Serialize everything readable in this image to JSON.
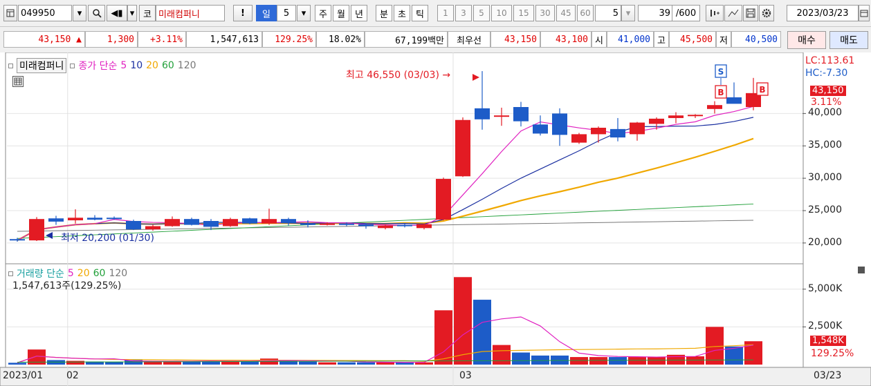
{
  "toolbar": {
    "code": "049950",
    "market_badge": "코",
    "stock_name": "미래컴퍼니",
    "alert_label": "!",
    "period_day": "일",
    "period_day_count": "5",
    "period_week": "주",
    "period_month": "월",
    "period_year": "년",
    "period_minute": "분",
    "period_second": "초",
    "period_tick": "틱",
    "intraday_counts": [
      "1",
      "3",
      "5",
      "10",
      "15",
      "30",
      "45",
      "60"
    ],
    "interval_value": "5",
    "data_count": "39",
    "data_total": "/600",
    "date": "2023/03/23"
  },
  "quote": {
    "price": "43,150",
    "change_arrow": "▲",
    "change": "1,300",
    "change_pct": "+3.11%",
    "volume": "1,547,613",
    "volume_ratio": "129.25%",
    "turnover": "18.02%",
    "amount": "67,199백만",
    "best_quote_label": "최우선",
    "ask": "43,150",
    "bid": "43,100",
    "open_label": "시",
    "open": "41,000",
    "high_label": "고",
    "high": "45,500",
    "low_label": "저",
    "low": "40,500",
    "buy_label": "매수",
    "sell_label": "매도"
  },
  "price_panel": {
    "legend_name": "미래컴퍼니",
    "legend_ma_label": "종가 단순",
    "ma_periods": [
      "5",
      "10",
      "20",
      "60",
      "120"
    ],
    "high_annotation": "최고 46,550 (03/03) →",
    "low_annotation": "최저 20,200 (01/30)",
    "lc_label": "LC:113.61",
    "hc_label": "HC:-7.30",
    "last_price_tag": "43,150",
    "last_pct_tag": "3.11%",
    "y_ticks": [
      "40,000",
      "35,000",
      "30,000",
      "25,000",
      "20,000"
    ],
    "signal_sell": "S",
    "signal_buy": "B"
  },
  "volume_panel": {
    "legend_label": "거래량 단순",
    "ma_periods": [
      "5",
      "20",
      "60",
      "120"
    ],
    "info": "1,547,613주(129.25%)",
    "y_ticks": [
      "5,000K",
      "2,500K"
    ],
    "last_vol_tag": "1,548K",
    "last_pct_tag": "129.25%"
  },
  "x_axis": {
    "labels": [
      "2023/01",
      "02",
      "03",
      "03/23"
    ]
  },
  "colors": {
    "up": "#e31b23",
    "down": "#1d5cc8",
    "ma5": "#e020c0",
    "ma10": "#1a2fa0",
    "ma20": "#f0a800",
    "ma60": "#22a03a",
    "ma120": "#777777"
  },
  "chart_data": {
    "type": "candlestick",
    "price_ylim": [
      17000,
      49000
    ],
    "volume_ylim": [
      0,
      6500000
    ],
    "candles": [
      {
        "o": 20600,
        "h": 20800,
        "l": 20200,
        "c": 20400,
        "v": 120000
      },
      {
        "o": 20400,
        "h": 24000,
        "l": 20300,
        "c": 23700,
        "v": 1000000
      },
      {
        "o": 23800,
        "h": 24200,
        "l": 22800,
        "c": 23300,
        "v": 300000
      },
      {
        "o": 23500,
        "h": 25200,
        "l": 23000,
        "c": 23900,
        "v": 250000
      },
      {
        "o": 23900,
        "h": 24300,
        "l": 23500,
        "c": 23600,
        "v": 200000
      },
      {
        "o": 23900,
        "h": 24100,
        "l": 23600,
        "c": 23700,
        "v": 180000
      },
      {
        "o": 23400,
        "h": 23600,
        "l": 22000,
        "c": 22100,
        "v": 300000
      },
      {
        "o": 22100,
        "h": 22800,
        "l": 21900,
        "c": 22600,
        "v": 200000
      },
      {
        "o": 22600,
        "h": 24100,
        "l": 22500,
        "c": 23700,
        "v": 250000
      },
      {
        "o": 23700,
        "h": 23900,
        "l": 22700,
        "c": 22800,
        "v": 200000
      },
      {
        "o": 23400,
        "h": 23700,
        "l": 22000,
        "c": 22500,
        "v": 250000
      },
      {
        "o": 22600,
        "h": 23900,
        "l": 22500,
        "c": 23700,
        "v": 250000
      },
      {
        "o": 23800,
        "h": 23900,
        "l": 22900,
        "c": 23000,
        "v": 200000
      },
      {
        "o": 23000,
        "h": 25300,
        "l": 22800,
        "c": 23700,
        "v": 400000
      },
      {
        "o": 23700,
        "h": 23900,
        "l": 22700,
        "c": 23100,
        "v": 250000
      },
      {
        "o": 23000,
        "h": 23500,
        "l": 22400,
        "c": 22900,
        "v": 200000
      },
      {
        "o": 22900,
        "h": 23200,
        "l": 22700,
        "c": 23000,
        "v": 150000
      },
      {
        "o": 23000,
        "h": 23200,
        "l": 22600,
        "c": 22800,
        "v": 150000
      },
      {
        "o": 22900,
        "h": 23100,
        "l": 22200,
        "c": 22600,
        "v": 150000
      },
      {
        "o": 22300,
        "h": 22800,
        "l": 22100,
        "c": 22700,
        "v": 150000
      },
      {
        "o": 22800,
        "h": 23000,
        "l": 22400,
        "c": 22600,
        "v": 150000
      },
      {
        "o": 22300,
        "h": 23000,
        "l": 22100,
        "c": 22900,
        "v": 150000
      },
      {
        "o": 23600,
        "h": 30100,
        "l": 23500,
        "c": 29900,
        "v": 3600000
      },
      {
        "o": 30300,
        "h": 39400,
        "l": 30200,
        "c": 39000,
        "v": 5800000
      },
      {
        "o": 40800,
        "h": 46550,
        "l": 37500,
        "c": 39100,
        "v": 4300000
      },
      {
        "o": 39600,
        "h": 40900,
        "l": 38100,
        "c": 39700,
        "v": 1300000
      },
      {
        "o": 41000,
        "h": 41800,
        "l": 38000,
        "c": 38800,
        "v": 800000
      },
      {
        "o": 38300,
        "h": 39700,
        "l": 36600,
        "c": 36900,
        "v": 600000
      },
      {
        "o": 40000,
        "h": 40800,
        "l": 35000,
        "c": 36700,
        "v": 600000
      },
      {
        "o": 35500,
        "h": 37000,
        "l": 35300,
        "c": 36800,
        "v": 500000
      },
      {
        "o": 36800,
        "h": 38000,
        "l": 35500,
        "c": 37800,
        "v": 500000
      },
      {
        "o": 37600,
        "h": 39300,
        "l": 35700,
        "c": 36300,
        "v": 500000
      },
      {
        "o": 36800,
        "h": 38700,
        "l": 35800,
        "c": 38600,
        "v": 500000
      },
      {
        "o": 38400,
        "h": 39400,
        "l": 37500,
        "c": 39200,
        "v": 500000
      },
      {
        "o": 39300,
        "h": 40200,
        "l": 38500,
        "c": 39700,
        "v": 650000
      },
      {
        "o": 39600,
        "h": 39900,
        "l": 39300,
        "c": 39800,
        "v": 550000
      },
      {
        "o": 40700,
        "h": 41900,
        "l": 40000,
        "c": 41300,
        "v": 2500000
      },
      {
        "o": 42500,
        "h": 44800,
        "l": 41600,
        "c": 41500,
        "v": 1200000
      },
      {
        "o": 41000,
        "h": 45500,
        "l": 40500,
        "c": 43150,
        "v": 1547613
      }
    ]
  }
}
